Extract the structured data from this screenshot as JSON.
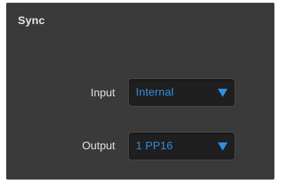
{
  "panel": {
    "title": "Sync"
  },
  "fields": {
    "input": {
      "label": "Input",
      "value": "Internal",
      "icon": "triangle-down-icon"
    },
    "output": {
      "label": "Output",
      "value": "1 PP16",
      "icon": "triangle-down-icon"
    }
  },
  "colors": {
    "panel_background": "#3a3a3a",
    "label_text": "#e2e2e2",
    "dropdown_background": "#1f1f1f",
    "accent_blue": "#2f8fe6"
  }
}
